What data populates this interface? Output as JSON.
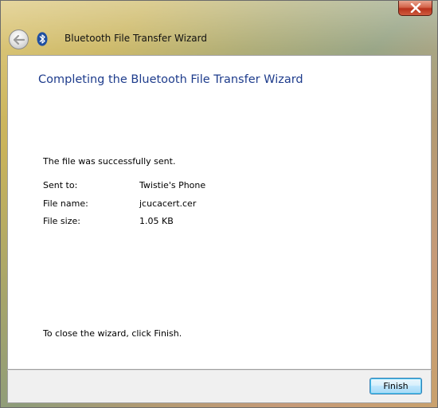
{
  "window": {
    "title": "Bluetooth File Transfer Wizard"
  },
  "content": {
    "heading": "Completing the Bluetooth File Transfer Wizard",
    "status_message": "The file was successfully sent.",
    "details": [
      {
        "label": "Sent to:",
        "value": "Twistie's Phone"
      },
      {
        "label": "File name:",
        "value": "jcucacert.cer"
      },
      {
        "label": "File size:",
        "value": "1.05 KB"
      }
    ],
    "close_hint": "To close the wizard, click Finish."
  },
  "footer": {
    "finish_label": "Finish"
  },
  "colors": {
    "heading": "#1e3c8c",
    "close_button": "#c7412a",
    "bluetooth": "#1f4fa0"
  },
  "icons": [
    "close-icon",
    "back-arrow-icon",
    "bluetooth-icon"
  ]
}
